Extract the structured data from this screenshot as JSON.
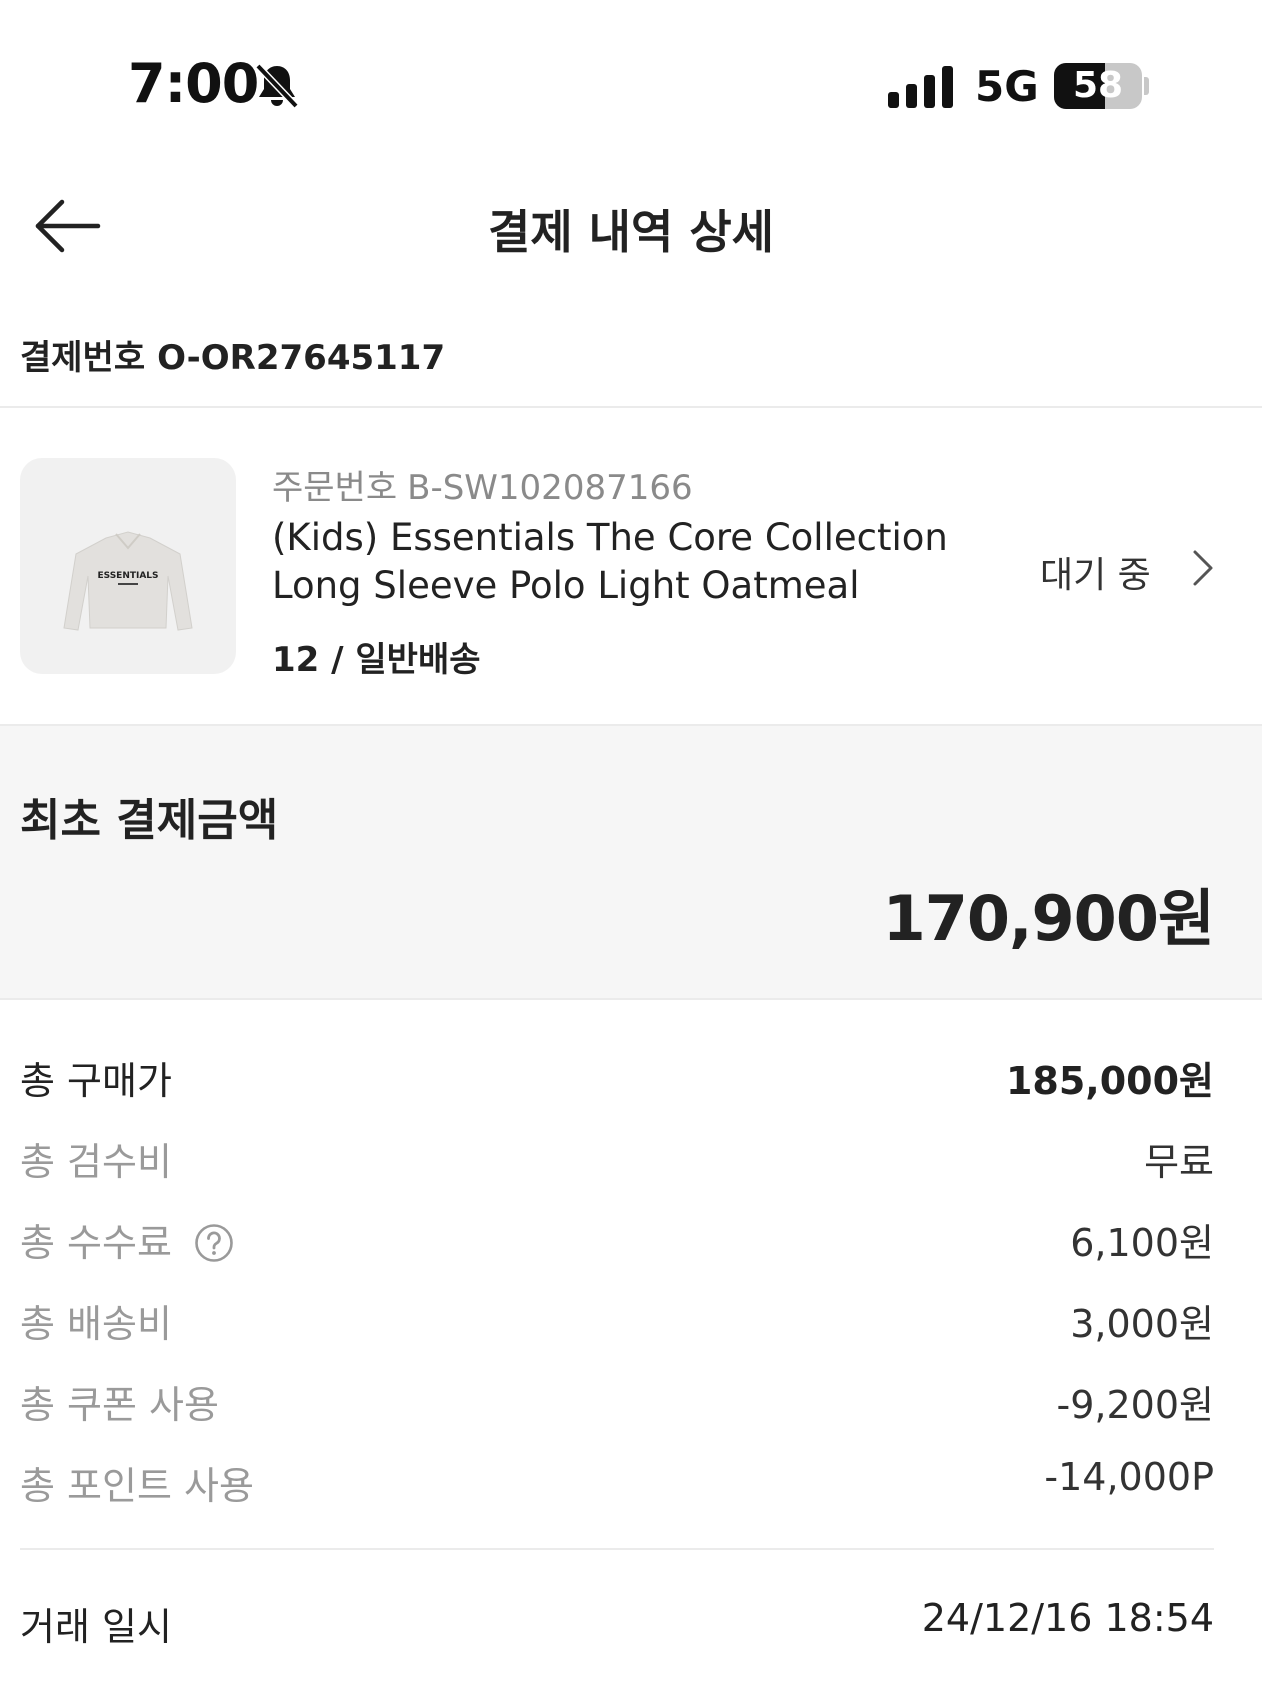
{
  "status_bar": {
    "time": "7:00",
    "network": "5G",
    "battery": "58",
    "battery_level_percent": 58,
    "icons": [
      "bell-slash-icon",
      "cellular-signal-icon",
      "battery-icon"
    ]
  },
  "header": {
    "title": "결제 내역 상세",
    "back_icon": "arrow-left-icon"
  },
  "payment": {
    "number_label": "결제번호",
    "number": "O-OR27645117"
  },
  "order": {
    "number_label": "주문번호",
    "number": "B-SW102087166",
    "product_name_line1": "(Kids) Essentials The Core Collection",
    "product_name_line2": "Long Sleeve Polo Light Oatmeal",
    "option": "12 / 일반배송",
    "status": "대기 중",
    "status_icon": "chevron-right-icon",
    "product_image_text": "ESSENTIALS"
  },
  "summary": {
    "label": "최초 결제금액",
    "amount": "170,900원"
  },
  "details": [
    {
      "label": "총 구매가",
      "value": "185,000원"
    },
    {
      "label": "총 검수비",
      "value": "무료"
    },
    {
      "label": "총 수수료",
      "value": "6,100원",
      "icon": "question-circle-icon"
    },
    {
      "label": "총 배송비",
      "value": "3,000원"
    },
    {
      "label": "총 쿠폰 사용",
      "value": "-9,200원"
    },
    {
      "label": "총 포인트 사용",
      "value": "-14,000P"
    }
  ],
  "transaction": {
    "label": "거래 일시",
    "value": "24/12/16 18:54"
  },
  "colors": {
    "text_primary": "#222222",
    "text_secondary": "#9a9a9a",
    "summary_background": "#f6f6f6",
    "divider": "#ebebeb"
  }
}
